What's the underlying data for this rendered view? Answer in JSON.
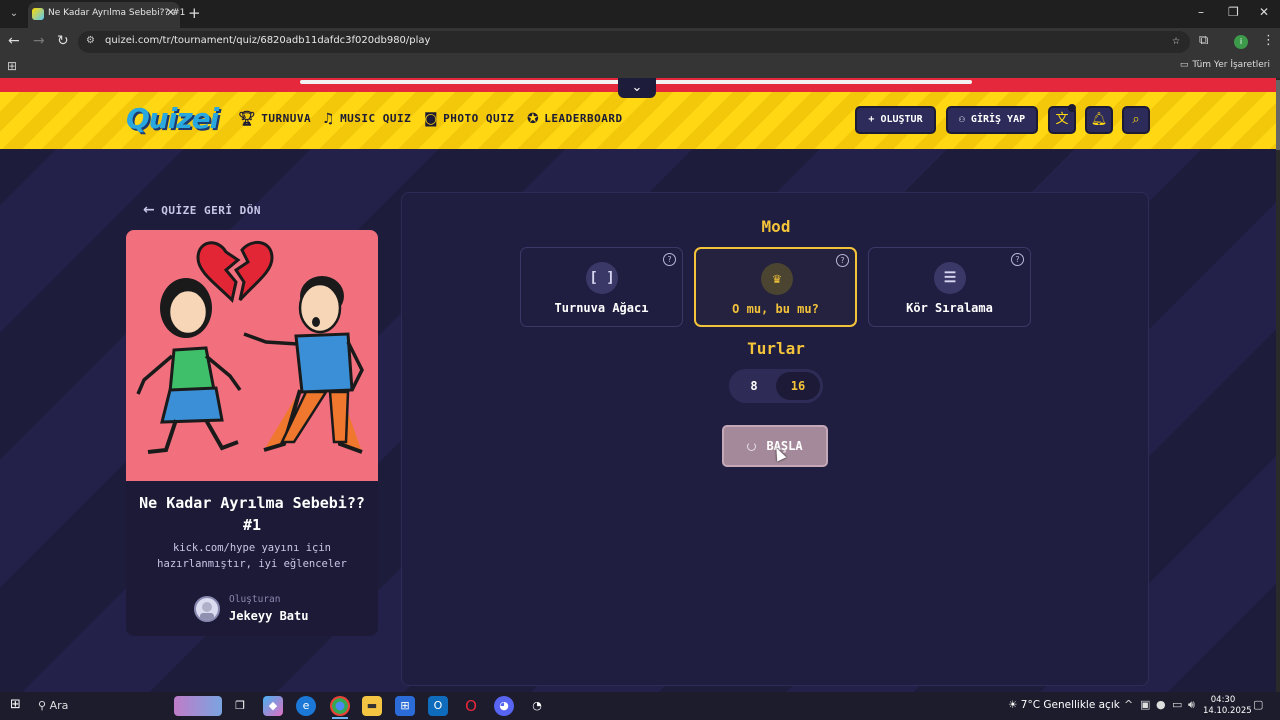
{
  "browser": {
    "tab_title": "Ne Kadar Ayrılma Sebebi?? #1",
    "tab_close": "✕",
    "new_tab": "+",
    "url": "quizei.com/tr/tournament/quiz/6820adb11dafdc3f020db980/play",
    "all_bookmarks": "Tüm Yer İşaretleri",
    "profile_initial": "i"
  },
  "site": {
    "logo": "Quizei",
    "nav": [
      {
        "label": "TURNUVA",
        "icon": "trophy-icon"
      },
      {
        "label": "MUSIC QUIZ",
        "icon": "music-note-icon"
      },
      {
        "label": "PHOTO QUIZ",
        "icon": "camera-icon"
      },
      {
        "label": "LEADERBOARD",
        "icon": "award-icon"
      }
    ],
    "create_label": "+ OLUŞTUR",
    "login_label": "GİRİŞ YAP"
  },
  "back_link": "QUİZE GERİ DÖN",
  "quiz": {
    "title": "Ne Kadar Ayrılma Sebebi?? #1",
    "description": "kick.com/hype yayını için hazırlanmıştır, iyi eğlenceler",
    "creator_label": "Oluşturan",
    "creator_name": "Jekeyy Batu"
  },
  "play": {
    "mode_title": "Mod",
    "modes": [
      {
        "label": "Turnuva Ağacı",
        "icon": "bracket-icon",
        "selected": false
      },
      {
        "label": "O mu, bu mu?",
        "icon": "crown-icon",
        "selected": true
      },
      {
        "label": "Kör Sıralama",
        "icon": "ranked-list-icon",
        "selected": false
      }
    ],
    "rounds_title": "Turlar",
    "rounds": [
      "8",
      "16"
    ],
    "selected_round": "16",
    "start_label": "BAŞLA"
  },
  "taskbar": {
    "search": "Ara",
    "weather": "7°C  Genellikle açık",
    "time": "04:30",
    "date": "14.10.2025"
  },
  "colors": {
    "accent": "#f3c33a",
    "header_yellow": "#ffd712",
    "page_bg": "#1f1d3d",
    "brand_blue": "#29a8e0"
  }
}
